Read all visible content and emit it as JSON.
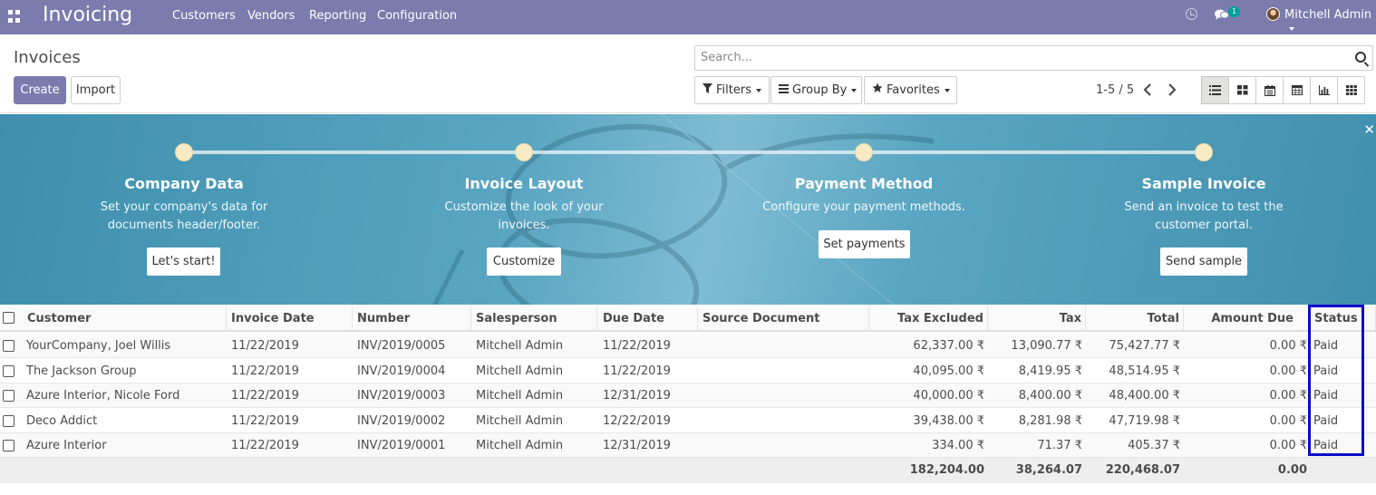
{
  "navbar": {
    "app_title": "Invoicing",
    "menu": [
      "Customers",
      "Vendors",
      "Reporting",
      "Configuration"
    ],
    "chat_badge": "1",
    "user": "Mitchell Admin",
    "icons": [
      "apps-grid-icon",
      "clock-icon",
      "chat-icon",
      "avatar"
    ]
  },
  "control_panel": {
    "breadcrumb": "Invoices",
    "create_label": "Create",
    "import_label": "Import",
    "search_placeholder": "Search...",
    "filters_label": "Filters",
    "group_by_label": "Group By",
    "favorites_label": "Favorites",
    "pager": "1-5 / 5",
    "views": [
      "list-view-icon",
      "kanban-view-icon",
      "calendar-view-icon",
      "pivot-view-icon",
      "graph-view-icon",
      "activity-view-icon"
    ],
    "active_view": "list-view-icon"
  },
  "banner": {
    "steps": [
      {
        "title": "Company Data",
        "desc1": "Set your company's data for",
        "desc2": "documents header/footer.",
        "button": "Let's start!"
      },
      {
        "title": "Invoice Layout",
        "desc1": "Customize the look of your",
        "desc2": "invoices.",
        "button": "Customize"
      },
      {
        "title": "Payment Method",
        "desc1": "Configure your payment methods.",
        "desc2": "",
        "button": "Set payments"
      },
      {
        "title": "Sample Invoice",
        "desc1": "Send an invoice to test the",
        "desc2": "customer portal.",
        "button": "Send sample"
      }
    ],
    "close_glyph": "✕"
  },
  "table": {
    "columns": [
      "Customer",
      "Invoice Date",
      "Number",
      "Salesperson",
      "Due Date",
      "Source Document",
      "Tax Excluded",
      "Tax",
      "Total",
      "Amount Due",
      "Status"
    ],
    "rows": [
      [
        "YourCompany, Joel Willis",
        "11/22/2019",
        "INV/2019/0005",
        "Mitchell Admin",
        "11/22/2019",
        "",
        "62,337.00 ₹",
        "13,090.77 ₹",
        "75,427.77 ₹",
        "0.00 ₹",
        "Paid"
      ],
      [
        "The Jackson Group",
        "11/22/2019",
        "INV/2019/0004",
        "Mitchell Admin",
        "11/22/2019",
        "",
        "40,095.00 ₹",
        "8,419.95 ₹",
        "48,514.95 ₹",
        "0.00 ₹",
        "Paid"
      ],
      [
        "Azure Interior, Nicole Ford",
        "11/22/2019",
        "INV/2019/0003",
        "Mitchell Admin",
        "12/31/2019",
        "",
        "40,000.00 ₹",
        "8,400.00 ₹",
        "48,400.00 ₹",
        "0.00 ₹",
        "Paid"
      ],
      [
        "Deco Addict",
        "11/22/2019",
        "INV/2019/0002",
        "Mitchell Admin",
        "12/22/2019",
        "",
        "39,438.00 ₹",
        "8,281.98 ₹",
        "47,719.98 ₹",
        "0.00 ₹",
        "Paid"
      ],
      [
        "Azure Interior",
        "11/22/2019",
        "INV/2019/0001",
        "Mitchell Admin",
        "12/31/2019",
        "",
        "334.00 ₹",
        "71.37 ₹",
        "405.37 ₹",
        "0.00 ₹",
        "Paid"
      ]
    ],
    "totals": {
      "tax_excluded": "182,204.00",
      "tax": "38,264.07",
      "total": "220,468.07",
      "amount_due": "0.00"
    }
  },
  "colors": {
    "brand": "#7c7bad",
    "highlight": "#0b0bc9",
    "badge": "#00a09d"
  }
}
